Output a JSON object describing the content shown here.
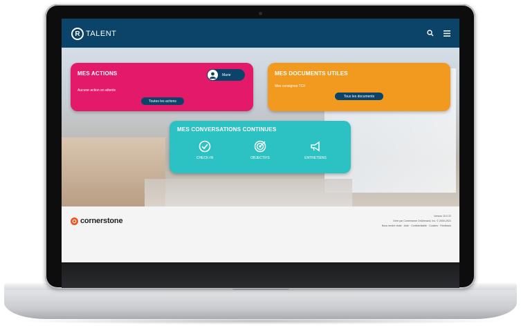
{
  "header": {
    "logo_mark": "R",
    "logo_text": "TALENT",
    "icons": [
      "search-icon",
      "menu-icon"
    ]
  },
  "actions_card": {
    "title": "MES ACTIONS",
    "status": "Aucune action en attente",
    "button": "Toutes les actions",
    "user_name": "Marie",
    "color": "#e3196a"
  },
  "documents_card": {
    "title": "MES DOCUMENTS UTILES",
    "subtitle": "Mes consignes TCF",
    "button": "Tous les documents",
    "color": "#f19a1f"
  },
  "conversations_card": {
    "title": "MES CONVERSATIONS CONTINUES",
    "color": "#2cc1c3",
    "items": [
      {
        "label": "CHECK-IN",
        "icon": "check-circle-icon"
      },
      {
        "label": "OBJECTIFS",
        "icon": "target-icon"
      },
      {
        "label": "ENTRETIENS",
        "icon": "megaphone-icon"
      }
    ]
  },
  "footer": {
    "brand": "cornerstone",
    "version": "Version 15.0.22",
    "line1": "Géré par Cornerstone OnDemand, Inc. © 2000-2021",
    "line2": "Nous rendre visite · Aide · Confidentialité · Cookies · Feedback"
  },
  "colors": {
    "topbar": "#0b4468",
    "pill": "#0b4468",
    "cornerstone_orange": "#f0531c"
  }
}
